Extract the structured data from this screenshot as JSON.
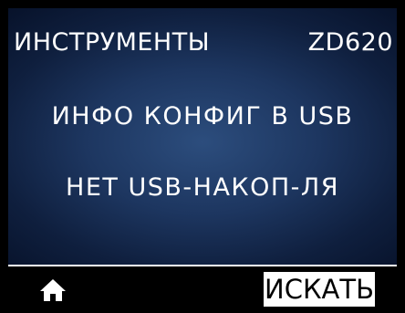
{
  "header": {
    "title": "ИНСТРУМЕНТЫ",
    "model": "ZD620"
  },
  "menu": {
    "item": "ИНФО КОНФИГ В USB",
    "status": "НЕТ USB-НАКОП-ЛЯ"
  },
  "footer": {
    "home_icon": "home-icon",
    "search_label": "ИСКАТЬ"
  },
  "colors": {
    "background": "#000000",
    "display_center": "#2c4d7d",
    "display_edge": "#07122a",
    "text": "#ffffff"
  }
}
